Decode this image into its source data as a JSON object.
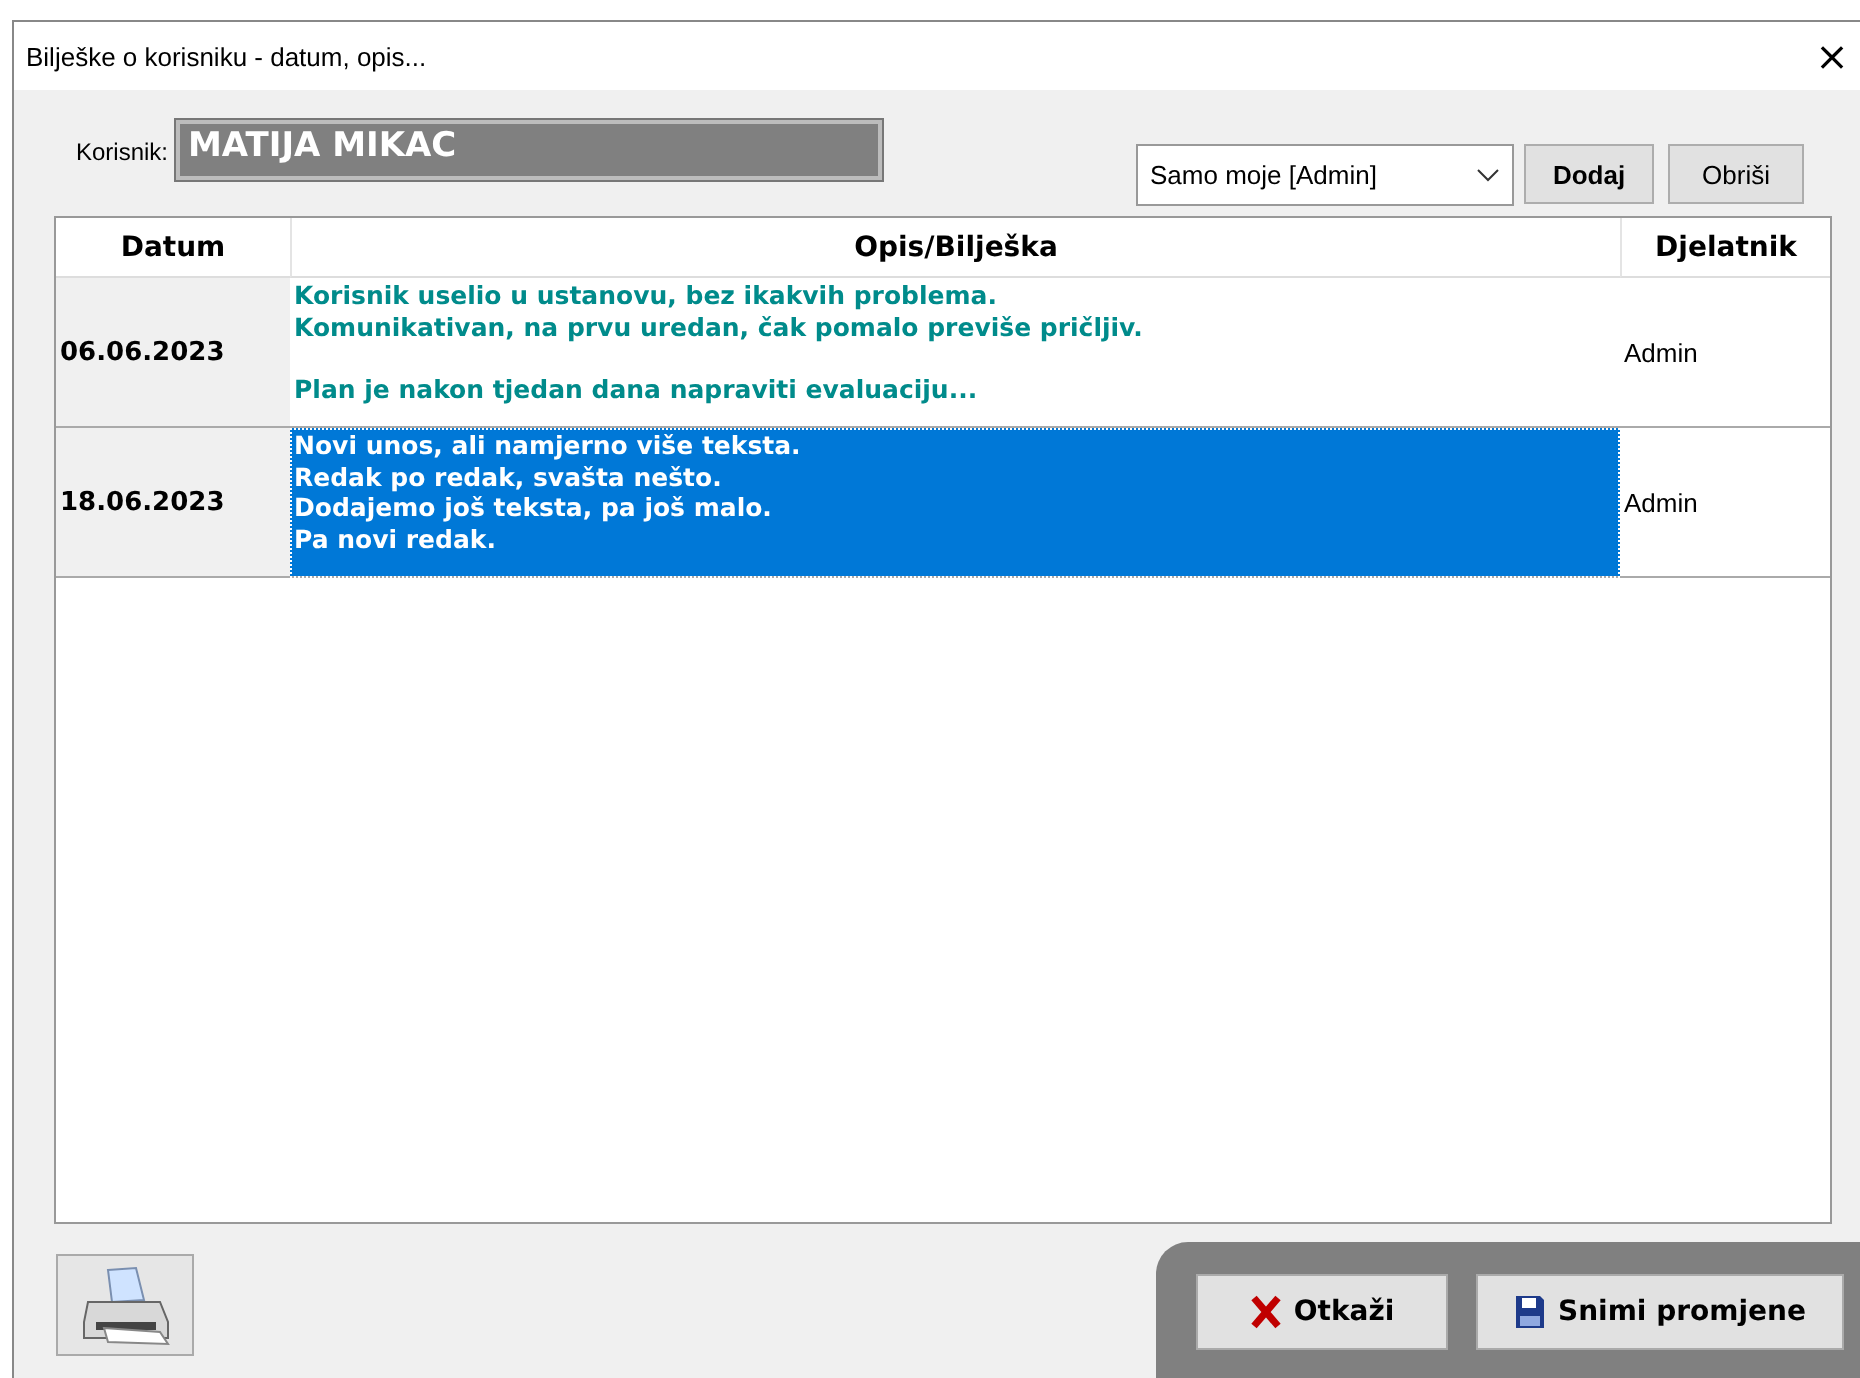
{
  "window": {
    "title": "Bilješke o korisniku - datum, opis...",
    "close": "×"
  },
  "user": {
    "label": "Korisnik:",
    "value": "MATIJA MIKAC"
  },
  "filter": {
    "value": "Samo moje [Admin]"
  },
  "toolbar_buttons": [
    "Dodaj",
    "Obriši"
  ],
  "table": {
    "columns": [
      "Datum",
      "Opis/Bilješka",
      "Djelatnik"
    ],
    "rows": [
      {
        "date": "06.06.2023",
        "note": "Korisnik uselio u ustanovu, bez ikakvih problema.\nKomunikativan, na prvu uredan, čak pomalo previše pričljiv.\n\nPlan je nakon tjedan dana napraviti evaluaciju...",
        "worker": "Admin",
        "selected": false
      },
      {
        "date": "18.06.2023",
        "note": "Novi unos, ali namjerno više teksta.\nRedak po redak, svašta nešto.\nDodajemo još teksta, pa još malo.\nPa novi redak.",
        "worker": "Admin",
        "selected": true
      }
    ]
  },
  "footer_buttons": [
    {
      "kind": "cancel",
      "label": "Otkaži"
    },
    {
      "kind": "save",
      "label": "Snimi promjene"
    }
  ]
}
